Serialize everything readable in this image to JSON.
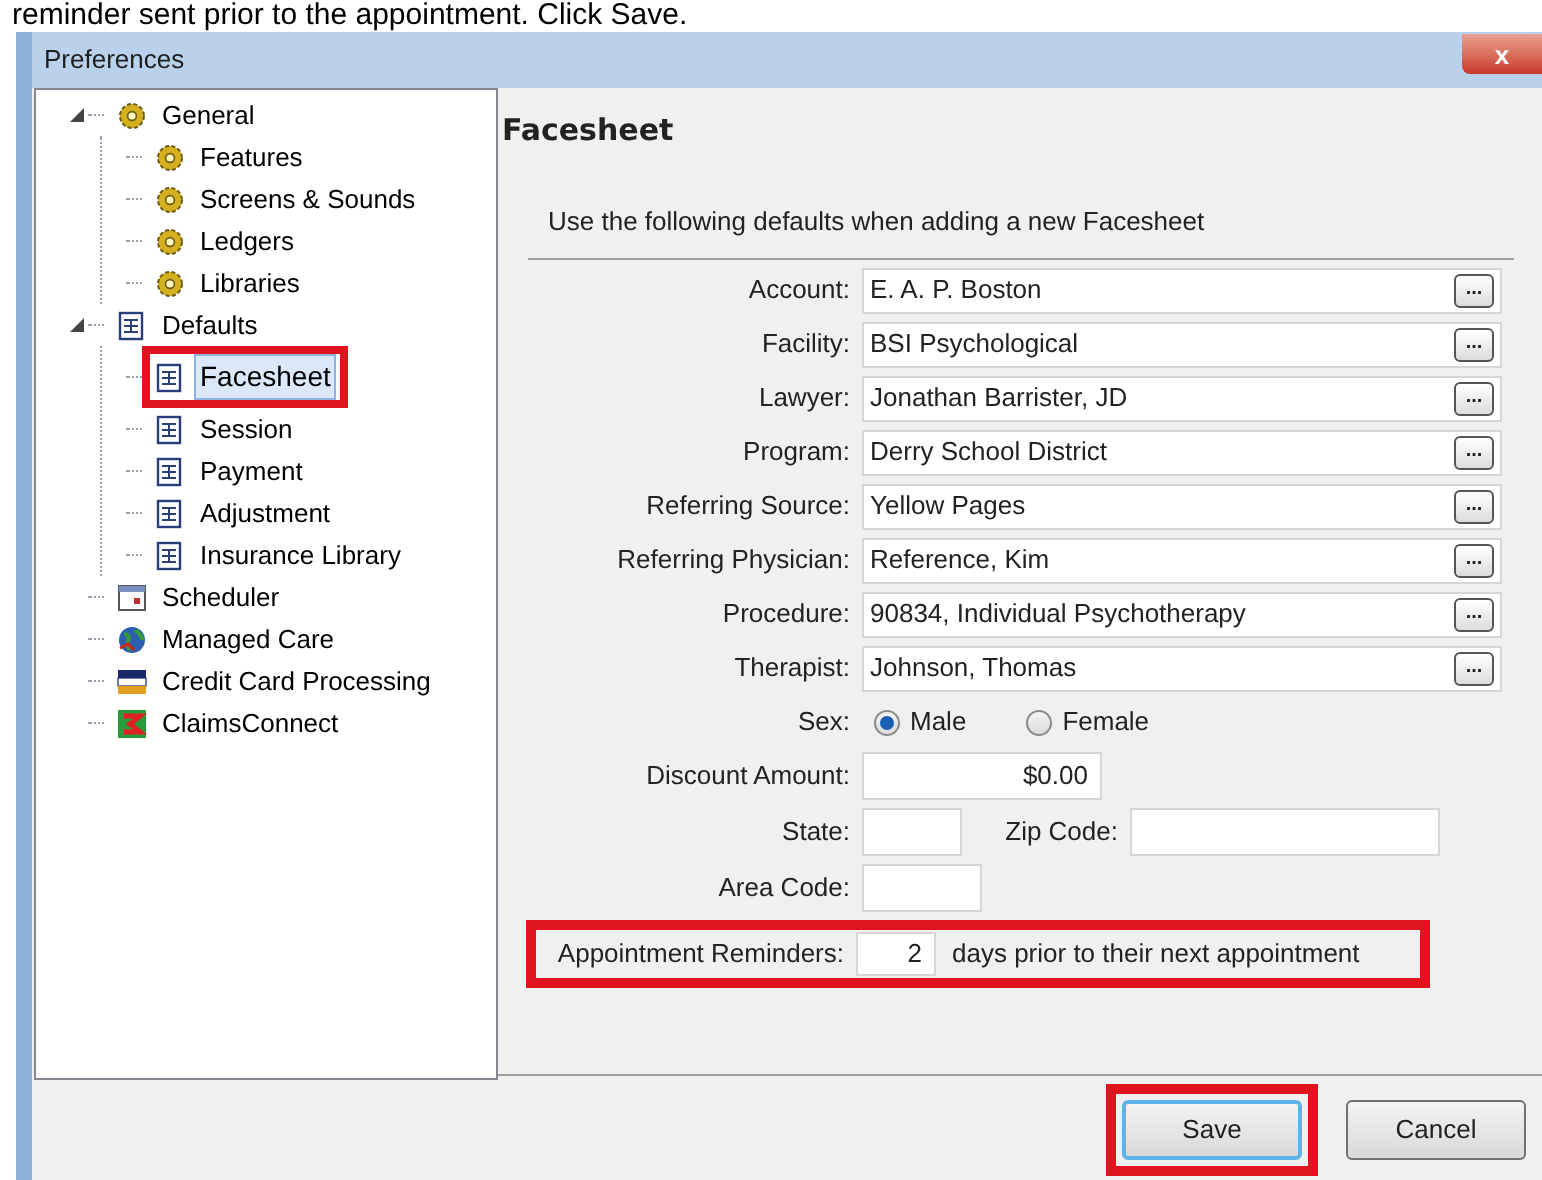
{
  "caption": "reminder sent prior to the appointment. Click Save.",
  "window": {
    "title": "Preferences",
    "close": "x"
  },
  "tree": [
    {
      "label": "General",
      "kind": "gear",
      "selected": false,
      "expanded": true,
      "children": [
        {
          "label": "Features",
          "kind": "gear",
          "selected": false
        },
        {
          "label": "Screens & Sounds",
          "kind": "gear",
          "selected": false
        },
        {
          "label": "Ledgers",
          "kind": "gear",
          "selected": false
        },
        {
          "label": "Libraries",
          "kind": "gear",
          "selected": false
        }
      ]
    },
    {
      "label": "Defaults",
      "kind": "sheet",
      "selected": false,
      "expanded": true,
      "children": [
        {
          "label": "Facesheet",
          "kind": "sheet",
          "selected": true,
          "highlighted": true
        },
        {
          "label": "Session",
          "kind": "sheet",
          "selected": false,
          "highlighted": false
        },
        {
          "label": "Payment",
          "kind": "sheet",
          "selected": false,
          "highlighted": false
        },
        {
          "label": "Adjustment",
          "kind": "sheet",
          "selected": false,
          "highlighted": false
        },
        {
          "label": "Insurance Library",
          "kind": "sheet",
          "selected": false,
          "highlighted": false
        }
      ]
    },
    {
      "label": "Scheduler",
      "kind": "calendar",
      "selected": false
    },
    {
      "label": "Managed Care",
      "kind": "globe",
      "selected": false
    },
    {
      "label": "Credit Card Processing",
      "kind": "card",
      "selected": false
    },
    {
      "label": "ClaimsConnect",
      "kind": "connect",
      "selected": false
    }
  ],
  "panel": {
    "title": "Facesheet",
    "subtitle": "Use the following defaults when adding a new Facesheet",
    "lookups": [
      {
        "label": "Account:",
        "value": "E. A. P. Boston",
        "button": "..."
      },
      {
        "label": "Facility:",
        "value": "BSI Psychological",
        "button": "..."
      },
      {
        "label": "Lawyer:",
        "value": "Jonathan Barrister, JD",
        "button": "..."
      },
      {
        "label": "Program:",
        "value": "Derry School District",
        "button": "..."
      },
      {
        "label": "Referring Source:",
        "value": "Yellow Pages",
        "button": "..."
      },
      {
        "label": "Referring Physician:",
        "value": "Reference, Kim",
        "button": "..."
      },
      {
        "label": "Procedure:",
        "value": "90834, Individual Psychotherapy",
        "button": "..."
      },
      {
        "label": "Therapist:",
        "value": "Johnson, Thomas",
        "button": "..."
      }
    ],
    "sex": {
      "label": "Sex:",
      "options": [
        {
          "label": "Male",
          "selected": true
        },
        {
          "label": "Female",
          "selected": false
        }
      ]
    },
    "discount": {
      "label": "Discount Amount:",
      "value": "$0.00"
    },
    "state": {
      "label": "State:"
    },
    "zip": {
      "label": "Zip Code:"
    },
    "area_code": {
      "label": "Area Code:"
    },
    "reminders": {
      "label": "Appointment Reminders:",
      "value": "2",
      "suffix": "days prior to their next appointment",
      "highlighted": true
    }
  },
  "buttons": [
    {
      "label": "Save",
      "default": true,
      "highlighted": true
    },
    {
      "label": "Cancel",
      "default": false,
      "highlighted": false
    }
  ]
}
